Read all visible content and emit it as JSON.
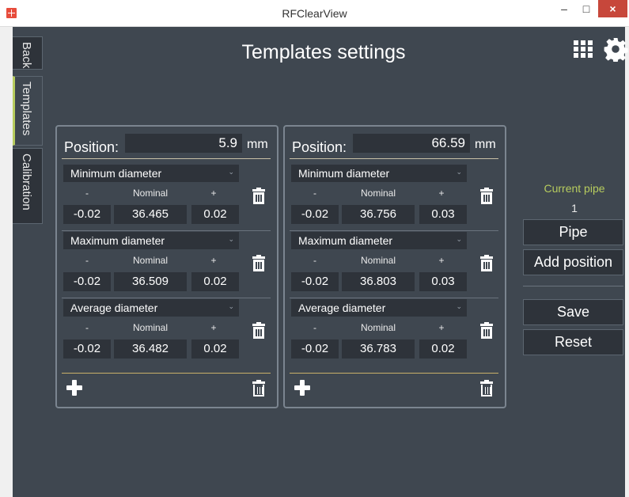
{
  "window": {
    "title": "RFClearView",
    "minimize_glyph": "–",
    "maximize_glyph": "□",
    "close_glyph": "×"
  },
  "nav": {
    "tabs": [
      {
        "label": "Back",
        "active": false
      },
      {
        "label": "Templates",
        "active": true
      },
      {
        "label": "Calibration",
        "active": false
      }
    ]
  },
  "header": {
    "title": "Templates settings",
    "icons": [
      "grid-icon",
      "gear-icon"
    ]
  },
  "templates": [
    {
      "position_label": "Position:",
      "position_value": "5.9",
      "unit": "mm",
      "measurements": [
        {
          "type": "Minimum diameter",
          "minus_label": "-",
          "nominal_label": "Nominal",
          "plus_label": "+",
          "minus": "-0.02",
          "nominal": "36.465",
          "plus": "0.02"
        },
        {
          "type": "Maximum diameter",
          "minus_label": "-",
          "nominal_label": "Nominal",
          "plus_label": "+",
          "minus": "-0.02",
          "nominal": "36.509",
          "plus": "0.02"
        },
        {
          "type": "Average diameter",
          "minus_label": "-",
          "nominal_label": "Nominal",
          "plus_label": "+",
          "minus": "-0.02",
          "nominal": "36.482",
          "plus": "0.02"
        }
      ]
    },
    {
      "position_label": "Position:",
      "position_value": "66.59",
      "unit": "mm",
      "measurements": [
        {
          "type": "Minimum diameter",
          "minus_label": "-",
          "nominal_label": "Nominal",
          "plus_label": "+",
          "minus": "-0.02",
          "nominal": "36.756",
          "plus": "0.03"
        },
        {
          "type": "Maximum diameter",
          "minus_label": "-",
          "nominal_label": "Nominal",
          "plus_label": "+",
          "minus": "-0.02",
          "nominal": "36.803",
          "plus": "0.03"
        },
        {
          "type": "Average diameter",
          "minus_label": "-",
          "nominal_label": "Nominal",
          "plus_label": "+",
          "minus": "-0.02",
          "nominal": "36.783",
          "plus": "0.02"
        }
      ]
    }
  ],
  "sidebar_right": {
    "current_pipe_label": "Current pipe",
    "current_pipe_value": "1",
    "pipe_button": "Pipe",
    "add_position_button": "Add position",
    "save_button": "Save",
    "reset_button": "Reset"
  },
  "colors": {
    "background": "#3f4750",
    "field": "#2e333a",
    "accent": "#b7cc5e",
    "close": "#c7473b"
  }
}
